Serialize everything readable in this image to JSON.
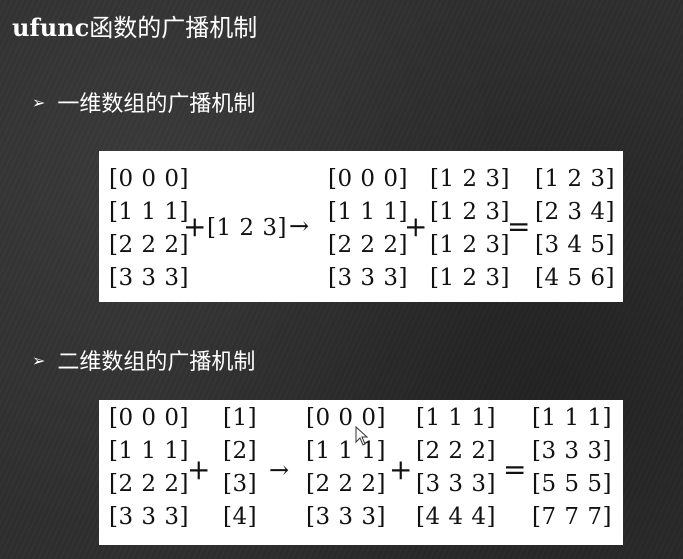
{
  "title": {
    "prefix": "ufunc",
    "rest": "函数的广播机制"
  },
  "bullets": [
    {
      "marker": "➢",
      "text": "一维数组的广播机制"
    },
    {
      "marker": "➢",
      "text": "二维数组的广播机制"
    }
  ],
  "one_d": {
    "a": [
      "[0 0 0]",
      "[1 1 1]",
      "[2 2 2]",
      "[3 3 3]"
    ],
    "plus_1": "+",
    "b": "[1 2 3]",
    "arrow": "→",
    "a2": [
      "[0 0 0]",
      "[1 1 1]",
      "[2 2 2]",
      "[3 3 3]"
    ],
    "plus_2": "+",
    "b2": [
      "[1 2 3]",
      "[1 2 3]",
      "[1 2 3]",
      "[1 2 3]"
    ],
    "equals": "=",
    "result": [
      "[1 2 3]",
      "[2 3 4]",
      "[3 4 5]",
      "[4 5 6]"
    ]
  },
  "two_d": {
    "a": [
      "[0 0 0]",
      "[1 1 1]",
      "[2 2 2]",
      "[3 3 3]"
    ],
    "plus_1": "+",
    "b": [
      "[1]",
      "[2]",
      "[3]",
      "[4]"
    ],
    "arrow": "→",
    "a2": [
      "[0 0 0]",
      "[1 1 1]",
      "[2 2 2]",
      "[3 3 3]"
    ],
    "plus_2": "+",
    "b2": [
      "[1 1 1]",
      "[2 2 2]",
      "[3 3 3]",
      "[4 4 4]"
    ],
    "equals": "=",
    "result": [
      "[1 1 1]",
      "[3 3 3]",
      "[5 5 5]",
      "[7 7 7]"
    ]
  }
}
